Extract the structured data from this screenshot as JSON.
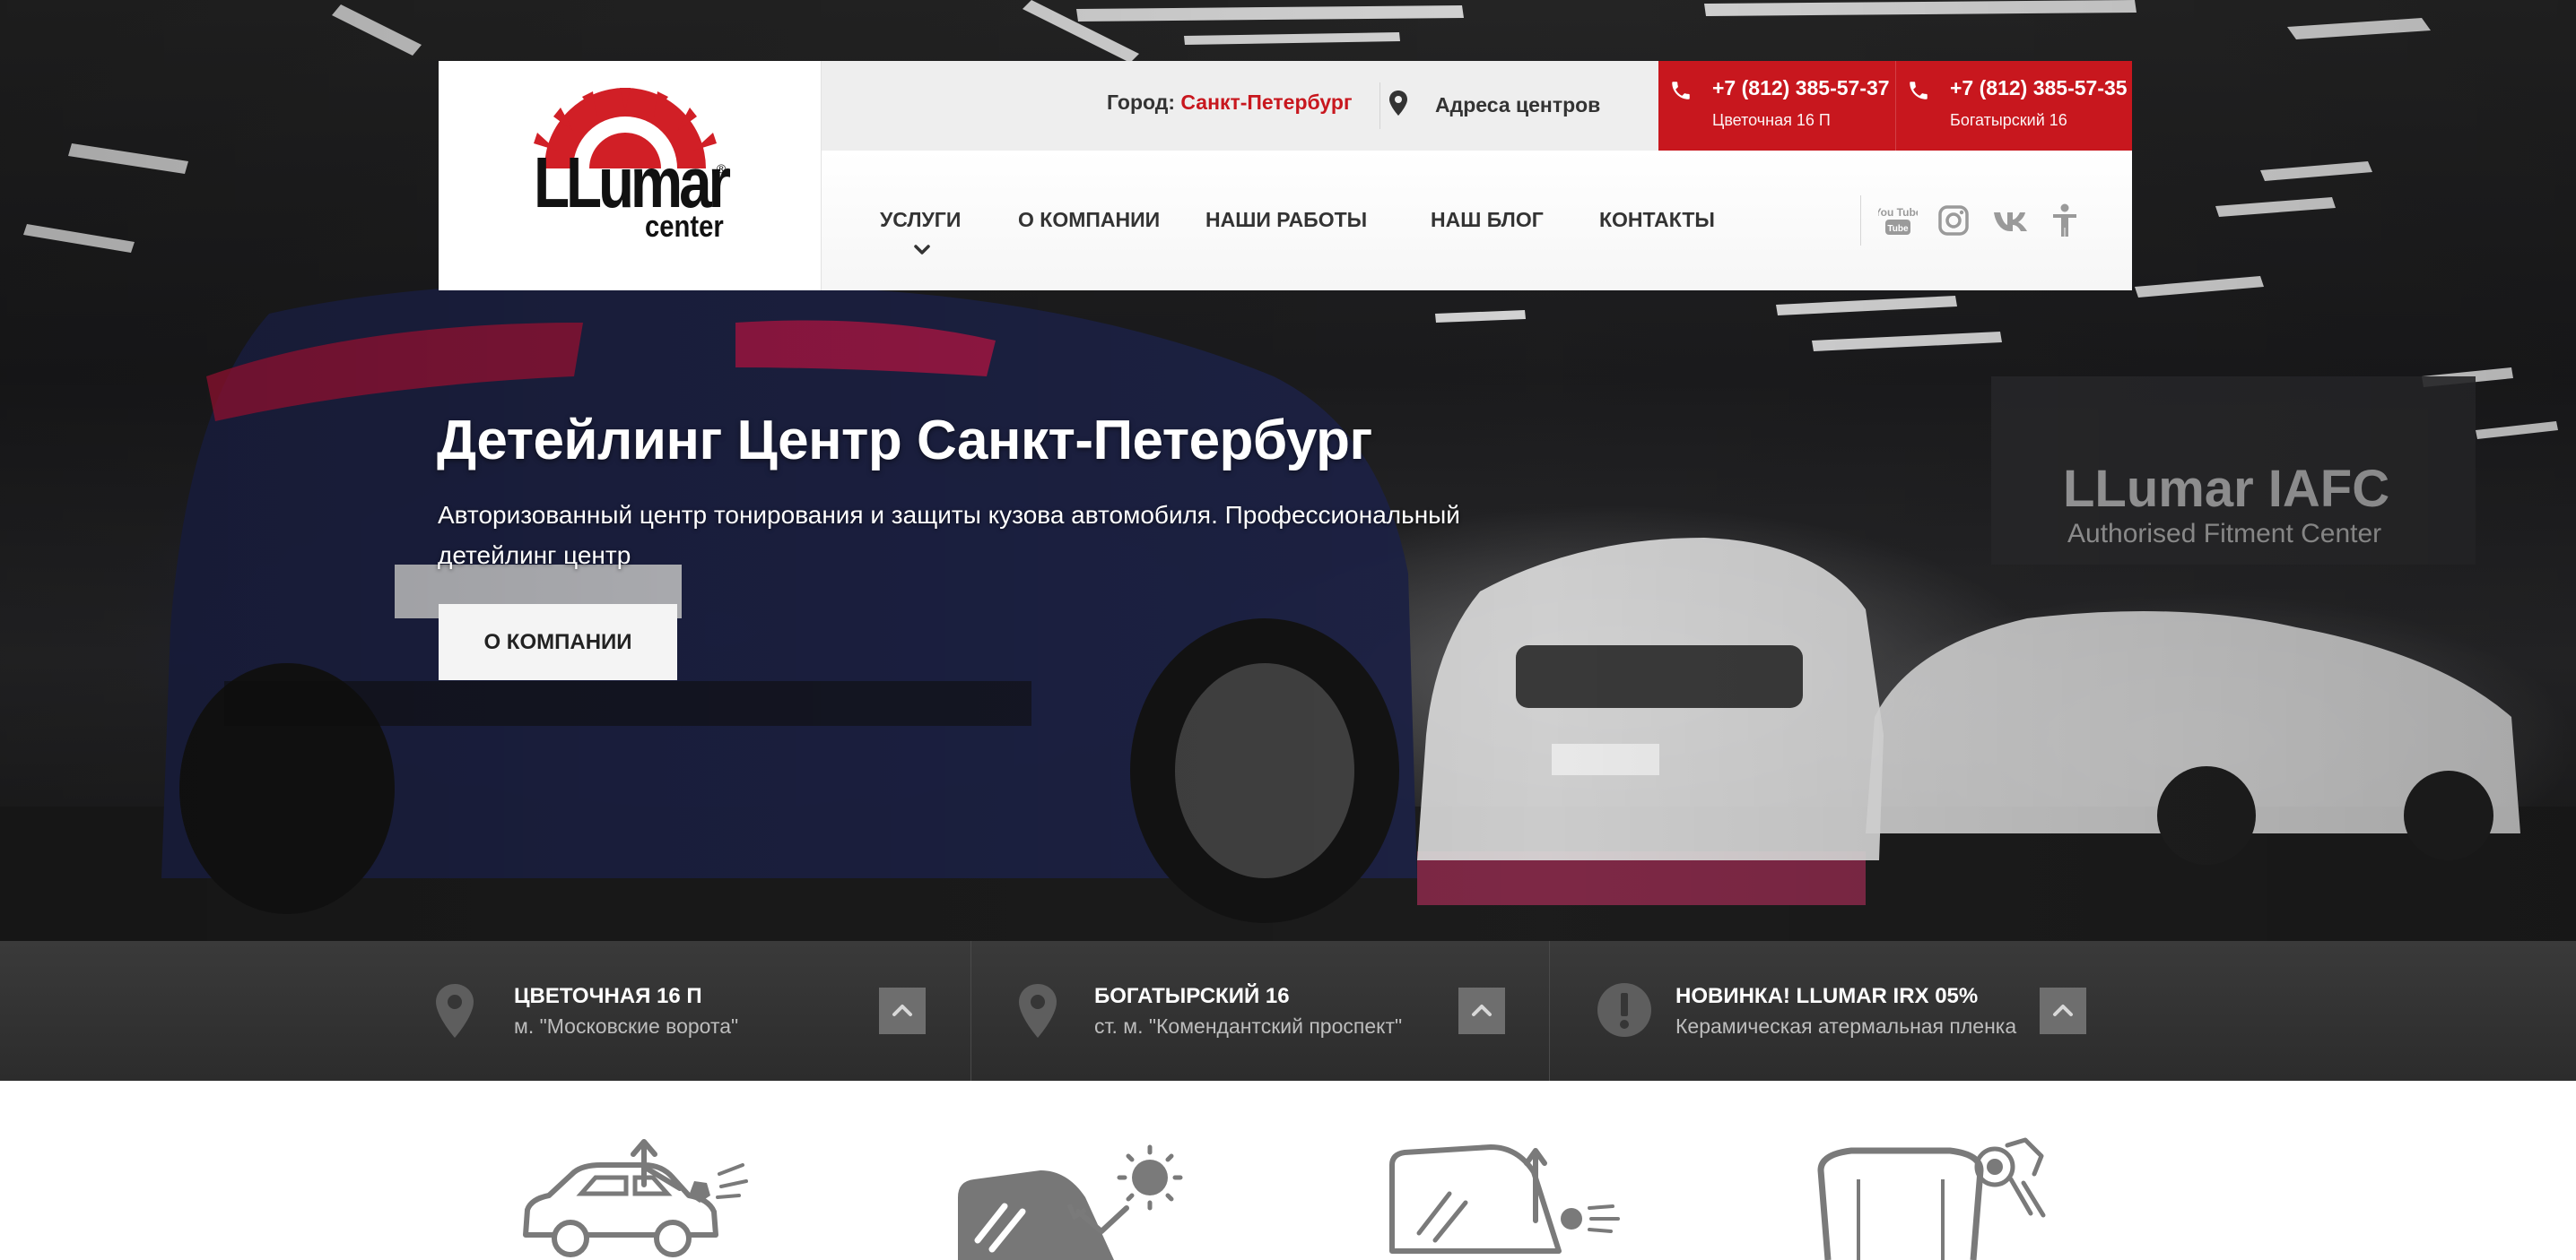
{
  "header": {
    "logo": {
      "name": "llumar-logo",
      "brand_text": "LLumar",
      "sub_text": "center",
      "reg_mark": "®"
    },
    "topbar": {
      "city_label": "Город:",
      "city_value": "Санкт-Петербург",
      "addresses_label": "Адреса центров",
      "phones": [
        {
          "number": "+7 (812) 385-57-37",
          "address": "Цветочная 16 П"
        },
        {
          "number": "+7 (812) 385-57-35",
          "address": "Богатырский 16"
        }
      ]
    },
    "nav": {
      "items": [
        {
          "label": "УСЛУГИ"
        },
        {
          "label": "О КОМПАНИИ"
        },
        {
          "label": "НАШИ РАБОТЫ"
        },
        {
          "label": "НАШ БЛОГ"
        },
        {
          "label": "КОНТАКТЫ"
        }
      ],
      "social": [
        "youtube-icon",
        "instagram-icon",
        "vk-icon",
        "accessibility-icon"
      ],
      "social_youtube_text": "You Tube"
    }
  },
  "hero": {
    "title": "Детейлинг Центр Санкт-Петербург",
    "subtitle": "Авторизованный центр тонирования и защиты кузова автомобиля. Профессиональный детейлинг центр",
    "button_label": "О КОМПАНИИ"
  },
  "info": [
    {
      "icon": "map-pin-icon",
      "title": "ЦВЕТОЧНАЯ 16 П",
      "text": "м. \"Московские ворота\""
    },
    {
      "icon": "map-pin-icon",
      "title": "БОГАТЫРСКИЙ 16",
      "text": "ст. м. \"Комендантский проспект\""
    },
    {
      "icon": "exclamation-icon",
      "title": "НОВИНКА! LLUMAR IRX 05%",
      "text": "Керамическая атермальная пленка"
    }
  ],
  "services": [
    "car-body-protection-icon",
    "window-tinting-icon",
    "windshield-protection-icon",
    "hood-protection-icon"
  ],
  "colors": {
    "brand_red": "#c8171e",
    "dark_strip": "#333333",
    "nav_text": "#333333"
  }
}
